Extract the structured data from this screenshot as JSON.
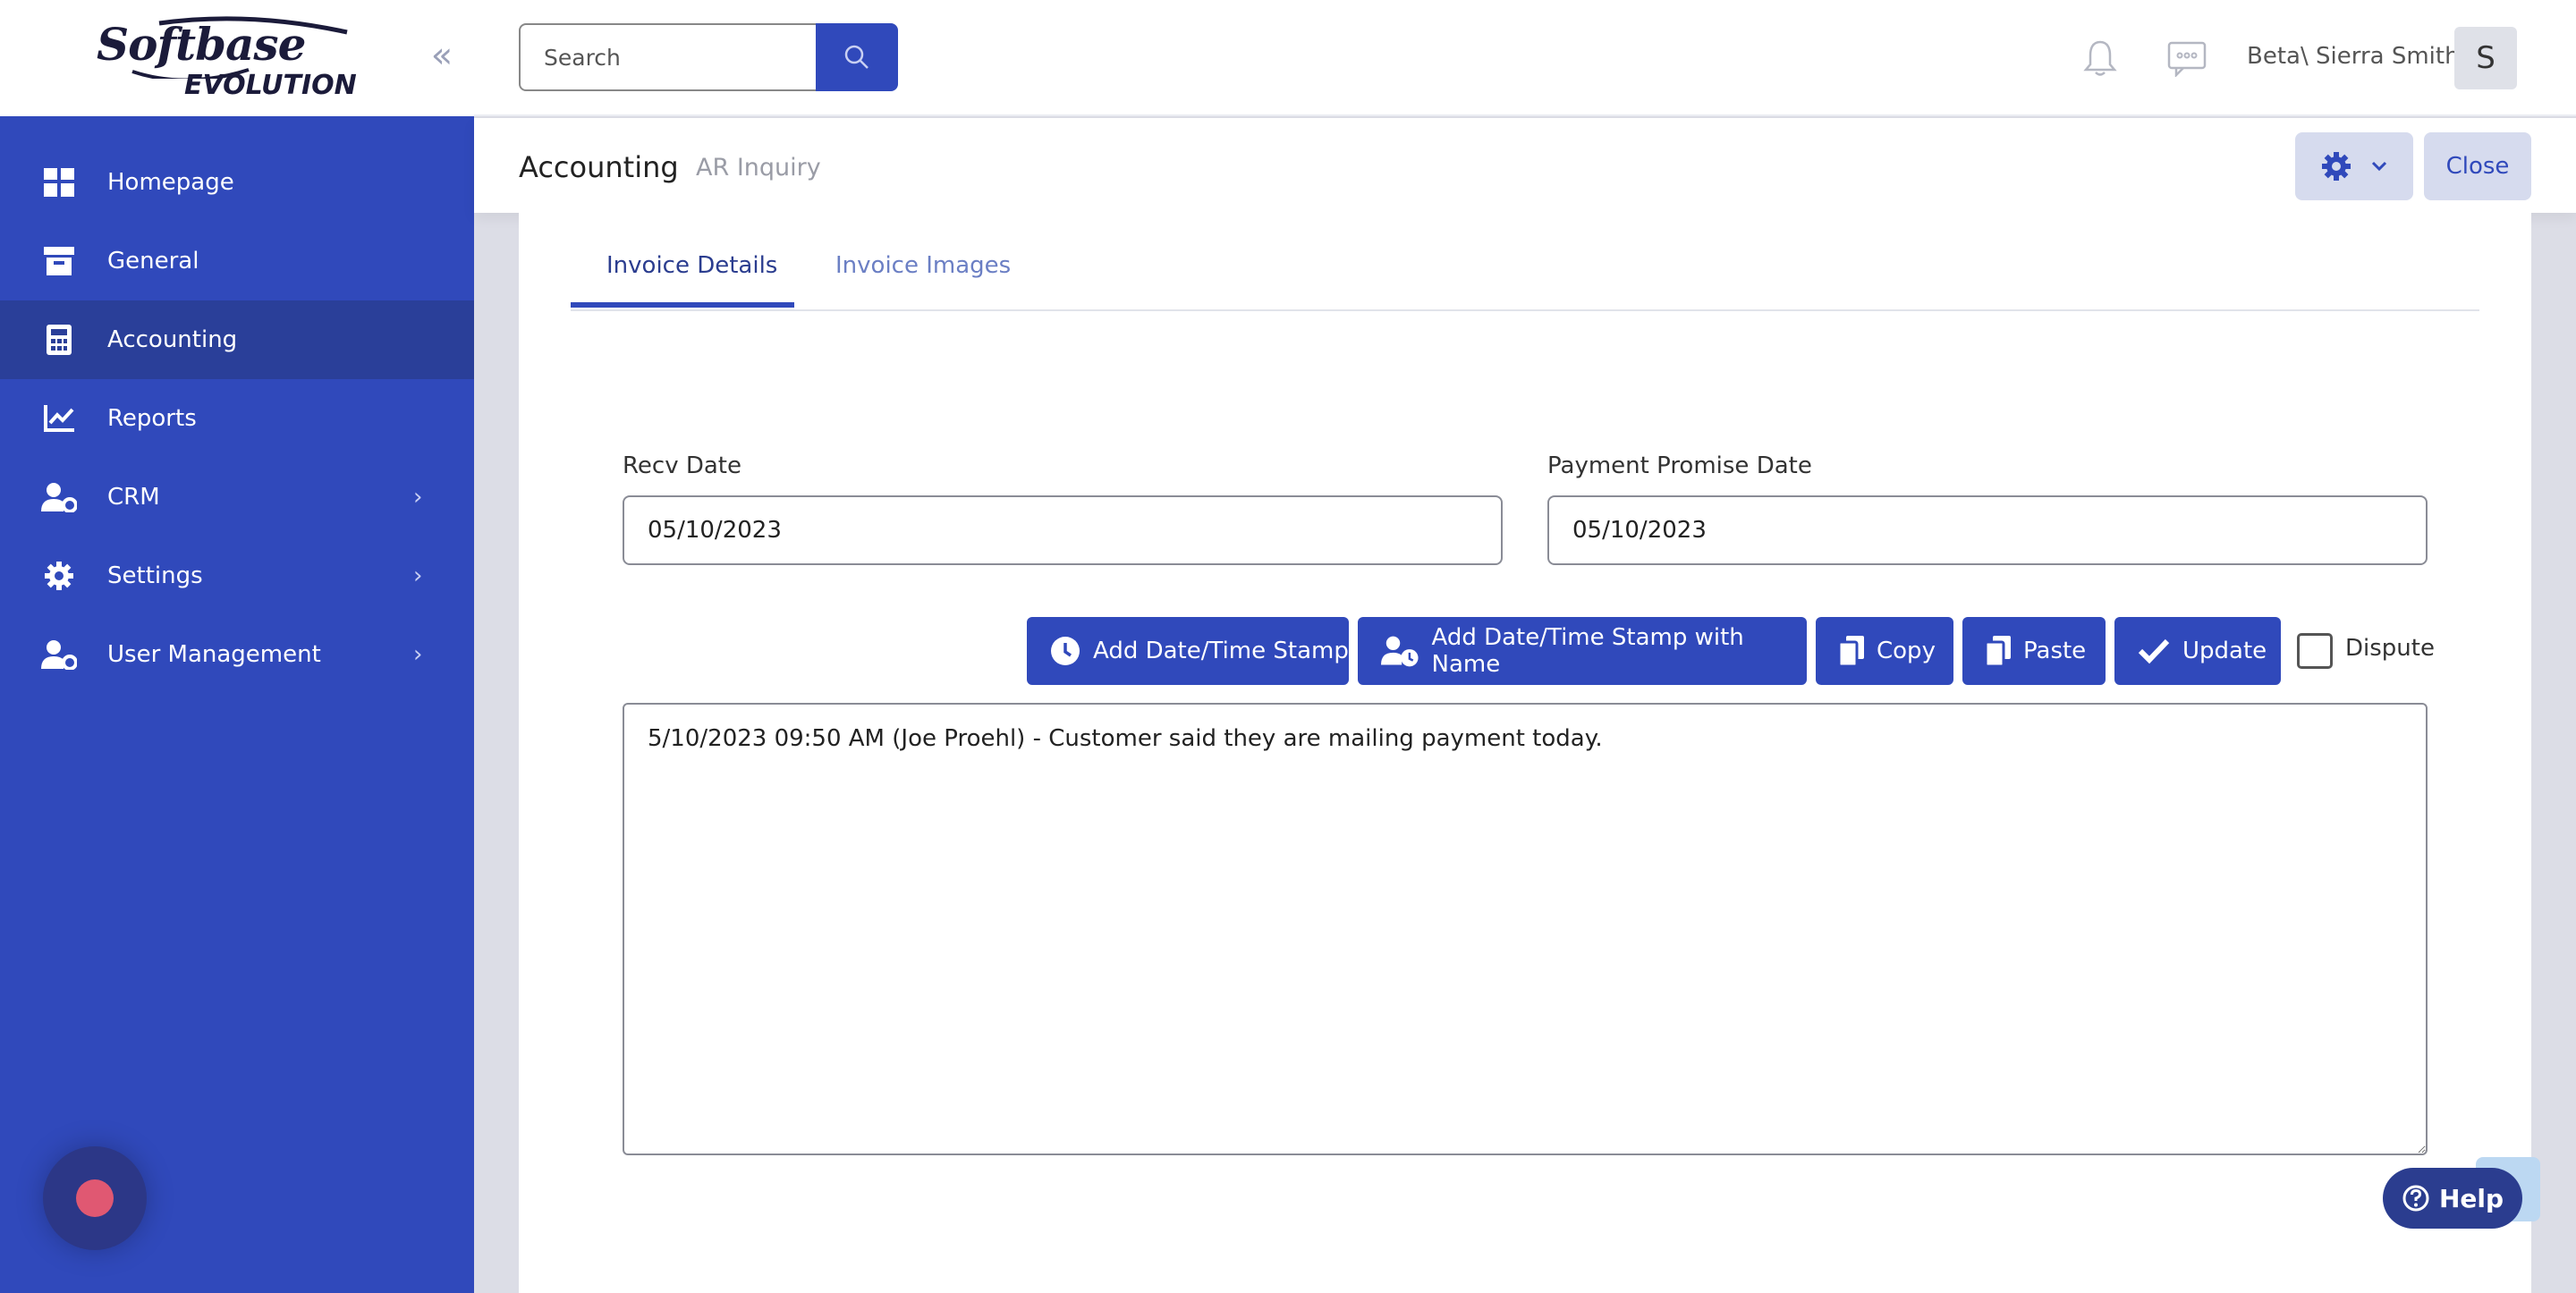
{
  "brand": {
    "line1": "Softbase",
    "line2": "EVOLUTION"
  },
  "sidebar": {
    "items": [
      {
        "label": "Homepage",
        "icon": "grid-icon"
      },
      {
        "label": "General",
        "icon": "archive-icon"
      },
      {
        "label": "Accounting",
        "icon": "calculator-icon",
        "active": true
      },
      {
        "label": "Reports",
        "icon": "chart-line-icon"
      },
      {
        "label": "CRM",
        "icon": "user-cog-icon",
        "has_submenu": true
      },
      {
        "label": "Settings",
        "icon": "gear-icon",
        "has_submenu": true
      },
      {
        "label": "User Management",
        "icon": "user-cog-icon",
        "has_submenu": true
      }
    ]
  },
  "topbar": {
    "search_placeholder": "Search",
    "user_name": "Beta\\ Sierra Smith",
    "avatar_initial": "S"
  },
  "subheader": {
    "breadcrumb_module": "Accounting",
    "breadcrumb_page": "AR Inquiry",
    "close_label": "Close"
  },
  "tabs": [
    {
      "label": "Invoice Details",
      "active": true
    },
    {
      "label": "Invoice Images",
      "active": false
    }
  ],
  "form": {
    "recv_date_label": "Recv Date",
    "recv_date_value": "05/10/2023",
    "promise_date_label": "Payment Promise Date",
    "promise_date_value": "05/10/2023",
    "buttons": {
      "add_stamp": "Add Date/Time Stamp",
      "add_stamp_name": "Add Date/Time Stamp with Name",
      "copy": "Copy",
      "paste": "Paste",
      "update": "Update"
    },
    "dispute_label": "Dispute",
    "dispute_checked": false,
    "notes": "5/10/2023 09:50 AM (Joe Proehl) - Customer said they are mailing payment today."
  },
  "help": {
    "label": "Help"
  },
  "colors": {
    "primary": "#3049bb",
    "active_nav": "#2a3f99",
    "chat": "#2c3787",
    "chat_dot": "#e05872"
  }
}
